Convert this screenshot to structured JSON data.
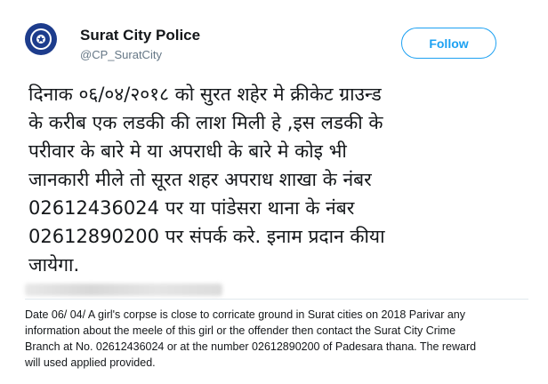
{
  "account": {
    "name": "Surat City Police",
    "handle": "@CP_SuratCity",
    "avatar_icon": "police-badge-icon"
  },
  "follow_label": "Follow",
  "tweet": {
    "lines": [
      "दिनाक ०६/०४/२०१८ को सुरत शहेर मे क्रीकेट ग्राउन्ड",
      "के करीब एक लडकी की लाश मिली हे ,इस लडकी के",
      "परीवार के बारे मे या अपराधी के बारे मे कोइ भी",
      "जानकारी मीले  तो सूरत शहर अपराध शाखा के नंबर",
      "02612436024  पर  या  पांडेसरा थाना के नंबर",
      "02612890200 पर संपर्क करे. इनाम प्रदान कीया",
      "जायेगा."
    ]
  },
  "translation": {
    "lines": [
      "Date 06/ 04/ A girl's corpse is close to corricate ground in Surat cities on 2018 Parivar any",
      "information about the meele of this girl or the offender then contact the Surat City Crime",
      "Branch at No. 02612436024 or at the number 02612890200 of Padesara thana. The reward",
      "will used applied provided."
    ]
  },
  "colors": {
    "accent": "#1da1f2",
    "avatar_bg": "#1d3c8c"
  }
}
